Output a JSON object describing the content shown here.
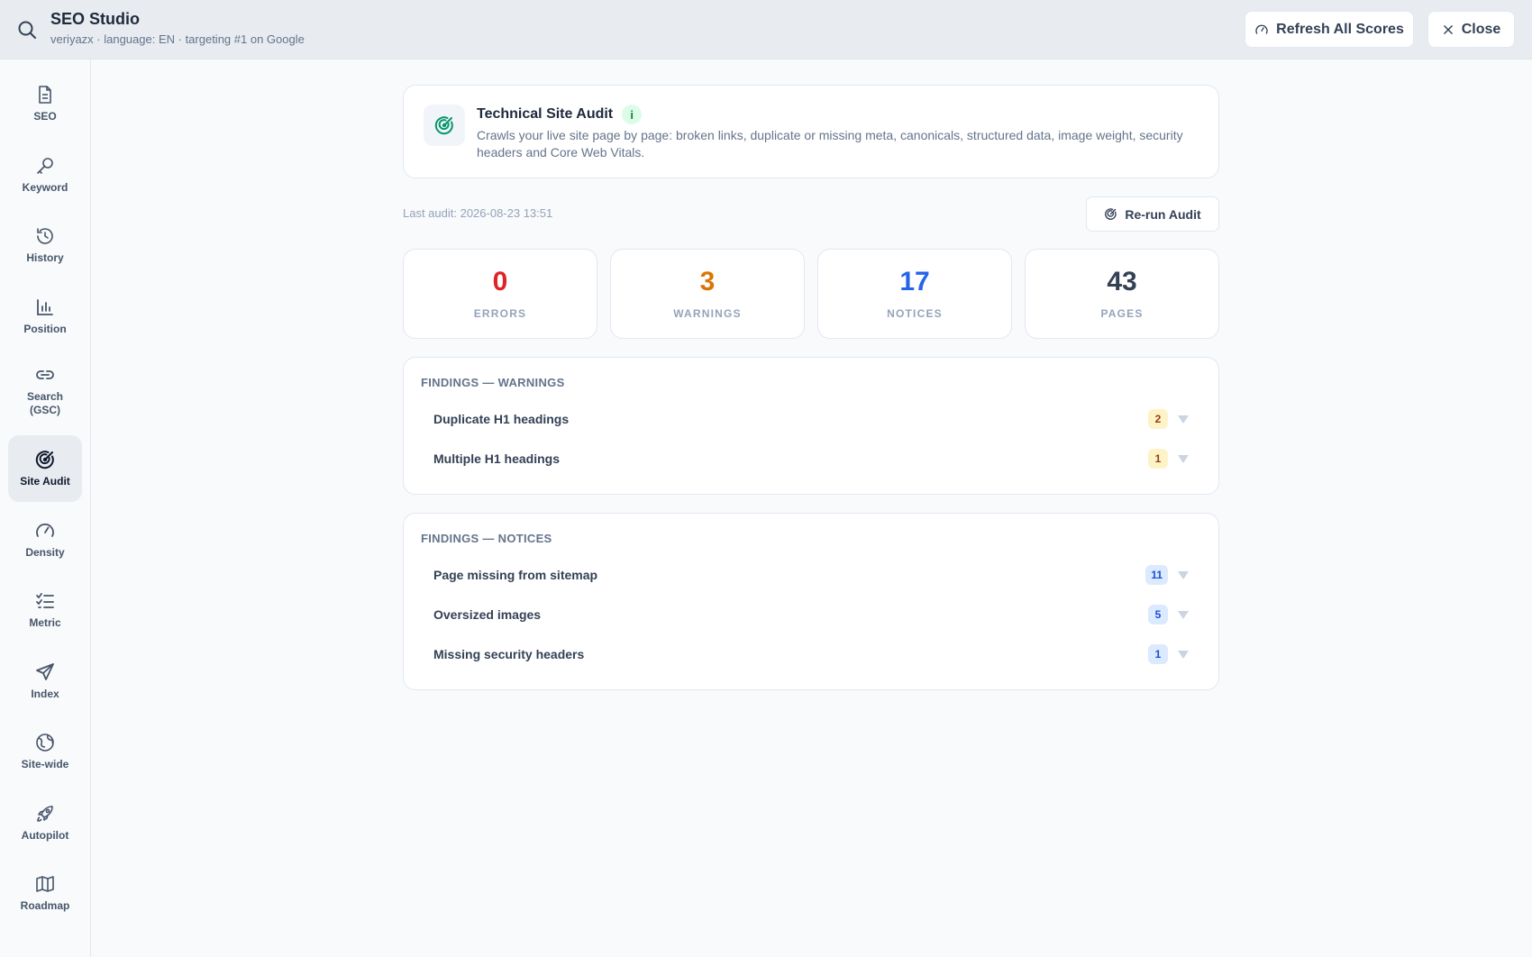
{
  "header": {
    "title": "SEO Studio",
    "subtitle": "veriyazx · language: EN · targeting #1 on Google",
    "refresh_label": "Refresh All Scores",
    "close_label": "Close"
  },
  "sidebar": {
    "items": [
      {
        "label": "SEO",
        "icon": "document-icon"
      },
      {
        "label": "Keyword",
        "icon": "key-icon"
      },
      {
        "label": "History",
        "icon": "history-icon"
      },
      {
        "label": "Position",
        "icon": "bar-chart-icon"
      },
      {
        "label": "Search\n(GSC)",
        "icon": "link-icon"
      },
      {
        "label": "Site Audit",
        "icon": "radar-icon",
        "active": true
      },
      {
        "label": "Density",
        "icon": "gauge-icon"
      },
      {
        "label": "Metric",
        "icon": "checklist-icon"
      },
      {
        "label": "Index",
        "icon": "send-icon"
      },
      {
        "label": "Site-wide",
        "icon": "globe-icon"
      },
      {
        "label": "Autopilot",
        "icon": "rocket-icon"
      },
      {
        "label": "Roadmap",
        "icon": "map-icon"
      }
    ]
  },
  "audit": {
    "title": "Technical Site Audit",
    "info_badge": "i",
    "description": "Crawls your live site page by page: broken links, duplicate or missing meta, canonicals, structured data, image weight, security headers and Core Web Vitals.",
    "last_audit": "Last audit: 2026-08-23 13:51",
    "rerun_label": "Re-run Audit"
  },
  "stats": [
    {
      "value": "0",
      "label": "ERRORS",
      "color": "#dc2626"
    },
    {
      "value": "3",
      "label": "WARNINGS",
      "color": "#d97706"
    },
    {
      "value": "17",
      "label": "NOTICES",
      "color": "#2563eb"
    },
    {
      "value": "43",
      "label": "PAGES",
      "color": "#334155"
    }
  ],
  "findings": {
    "warnings": {
      "heading": "FINDINGS — WARNINGS",
      "items": [
        {
          "label": "Duplicate H1 headings",
          "count": "2"
        },
        {
          "label": "Multiple H1 headings",
          "count": "1"
        }
      ]
    },
    "notices": {
      "heading": "FINDINGS — NOTICES",
      "items": [
        {
          "label": "Page missing from sitemap",
          "count": "11"
        },
        {
          "label": "Oversized images",
          "count": "5"
        },
        {
          "label": "Missing security headers",
          "count": "1"
        }
      ]
    }
  },
  "colors": {
    "accent_green": "#059669",
    "error": "#dc2626",
    "warning": "#d97706",
    "notice": "#2563eb"
  }
}
